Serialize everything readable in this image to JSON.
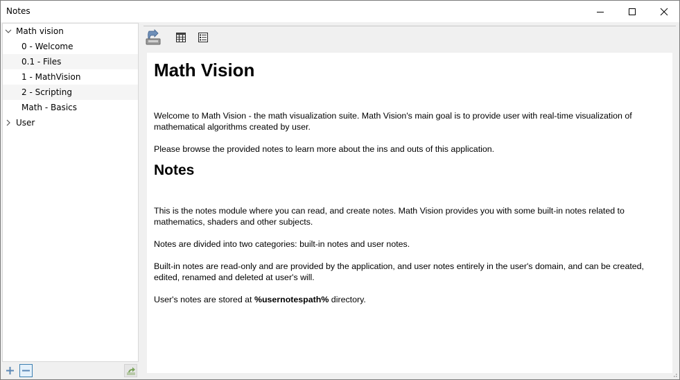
{
  "window": {
    "title": "Notes",
    "controls": [
      "minimize",
      "maximize",
      "close"
    ]
  },
  "sidebar": {
    "tree": [
      {
        "label": "Math vision",
        "expanded": true,
        "children": [
          "0 - Welcome",
          "0.1 - Files",
          "1 - MathVision",
          "2 - Scripting",
          "Math - Basics"
        ]
      },
      {
        "label": "User",
        "expanded": false,
        "children": []
      }
    ],
    "bottom_buttons": [
      "add-note",
      "remove-note",
      "export-note"
    ]
  },
  "toolbar": {
    "buttons": [
      "import-icon",
      "table-view-icon",
      "list-view-icon"
    ]
  },
  "document": {
    "heading1": "Math Vision",
    "para1": "Welcome to Math Vision - the math visualization suite. Math Vision's main goal is to provide user with real-time visualization of mathematical algorithms created by user.",
    "para2": "Please browse the provided notes to learn more about the ins and outs of this application.",
    "heading2": "Notes",
    "para3": "This is the notes module where you can read, and create notes. Math Vision provides you with some built-in notes related to mathematics, shaders and other subjects.",
    "para4": "Notes are divided into two categories: built-in notes and user notes.",
    "para5": "Built-in notes are read-only and are provided by the application, and user notes entirely in the user's domain, and can be created, edited, renamed and deleted at user's will.",
    "para6_prefix": "User's notes are stored at ",
    "para6_bold": "%usernotespath%",
    "para6_suffix": " directory."
  }
}
